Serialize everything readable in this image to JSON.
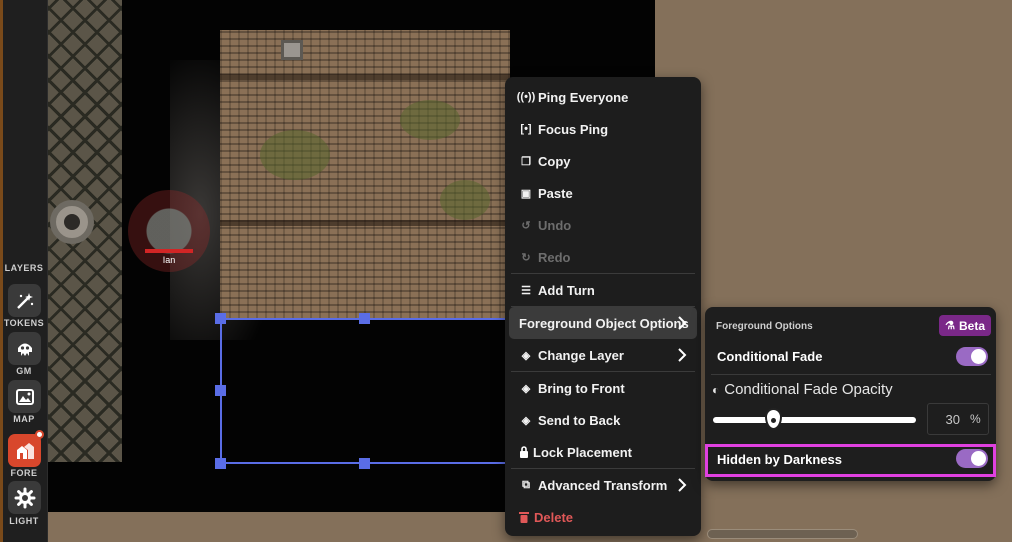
{
  "toolbar": {
    "layers_label": "LAYERS",
    "items": [
      {
        "label": "TOKENS",
        "icon": "magic-wand-icon"
      },
      {
        "label": "GM",
        "icon": "gm-monster-icon"
      },
      {
        "label": "MAP",
        "icon": "map-image-icon"
      },
      {
        "label": "FORE",
        "icon": "foreground-buildings-icon",
        "active": true
      },
      {
        "label": "LIGHT",
        "icon": "light-gear-icon"
      }
    ],
    "active_color": "#d8472c"
  },
  "map": {
    "token_name": "Ian",
    "selection_color": "#5a6de6"
  },
  "context_menu": {
    "ping_everyone": "Ping Everyone",
    "focus_ping": "Focus Ping",
    "copy": "Copy",
    "paste": "Paste",
    "undo": "Undo",
    "redo": "Redo",
    "add_turn": "Add Turn",
    "foreground_options": "Foreground Object Options",
    "change_layer": "Change Layer",
    "bring_to_front": "Bring to Front",
    "send_to_back": "Send to Back",
    "lock_placement": "Lock Placement",
    "advanced_transform": "Advanced Transform",
    "delete": "Delete",
    "disabled_items": [
      "Undo",
      "Redo"
    ],
    "danger_color": "#e05858"
  },
  "foreground_panel": {
    "title": "Foreground Options",
    "beta_label": "Beta",
    "beta_color": "#7a2888",
    "conditional_fade_label": "Conditional Fade",
    "conditional_fade_on": true,
    "opacity_label": "Conditional Fade Opacity",
    "opacity_value": "30",
    "opacity_unit": "%",
    "opacity_slider_fraction": 0.3,
    "hidden_by_darkness_label": "Hidden by Darkness",
    "hidden_by_darkness_on": true,
    "toggle_color": "#9a6ac4",
    "highlight_color": "#e040e0"
  }
}
